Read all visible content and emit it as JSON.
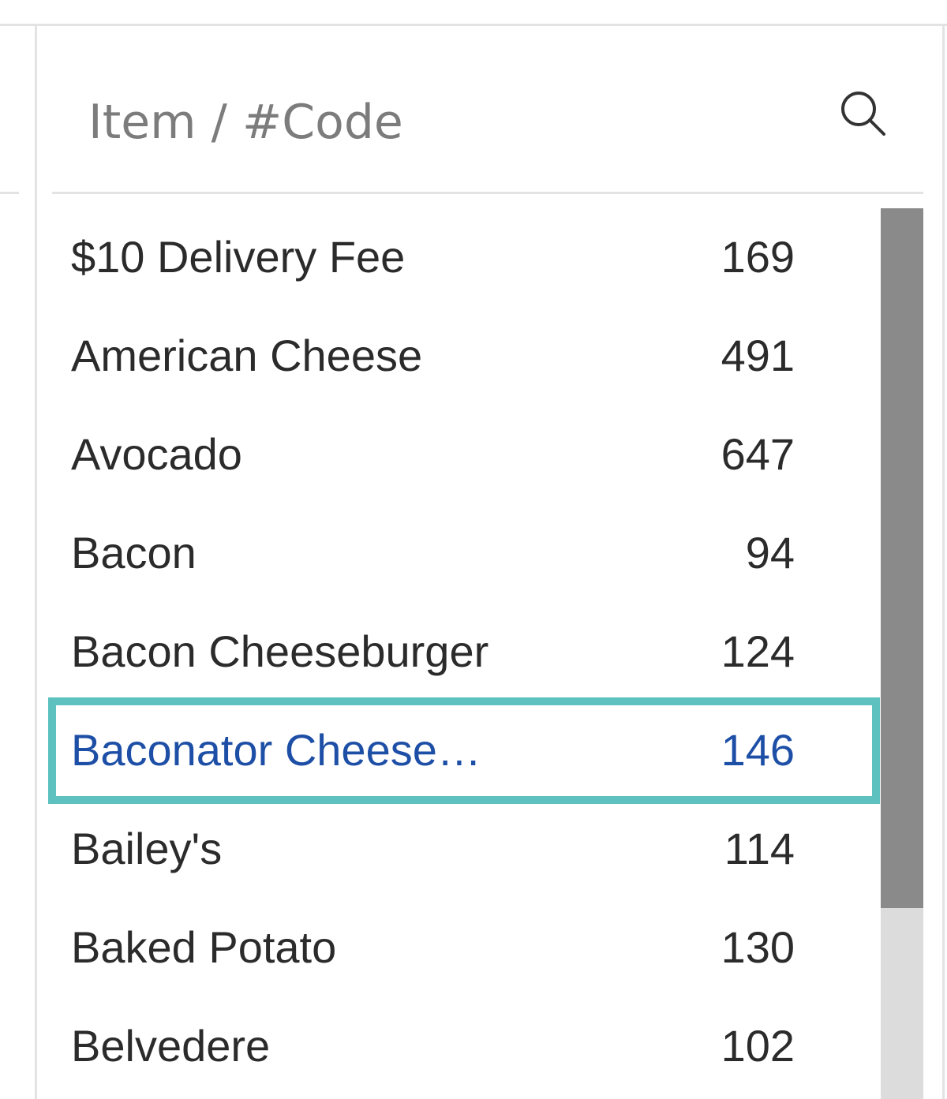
{
  "search": {
    "placeholder": "Item / #Code",
    "value": "",
    "icon": "search-icon"
  },
  "items": [
    {
      "name": "$10 Delivery Fee",
      "code": "169"
    },
    {
      "name": "American Cheese",
      "code": "491"
    },
    {
      "name": "Avocado",
      "code": "647"
    },
    {
      "name": "Bacon",
      "code": "94"
    },
    {
      "name": "Bacon Cheeseburger",
      "code": "124"
    },
    {
      "name": "Baconator Cheese…",
      "code": "146"
    },
    {
      "name": "Bailey's",
      "code": "114"
    },
    {
      "name": "Baked Potato",
      "code": "130"
    },
    {
      "name": "Belvedere",
      "code": "102"
    }
  ],
  "selected_index": 5,
  "colors": {
    "selected_outline": "#5cc1bf",
    "selected_text": "#1e4fa6",
    "text": "#2b2b2b",
    "placeholder": "#7c7c7c",
    "scrollbar_thumb": "#8a8a8a",
    "scrollbar_track": "#dcdcdc"
  }
}
